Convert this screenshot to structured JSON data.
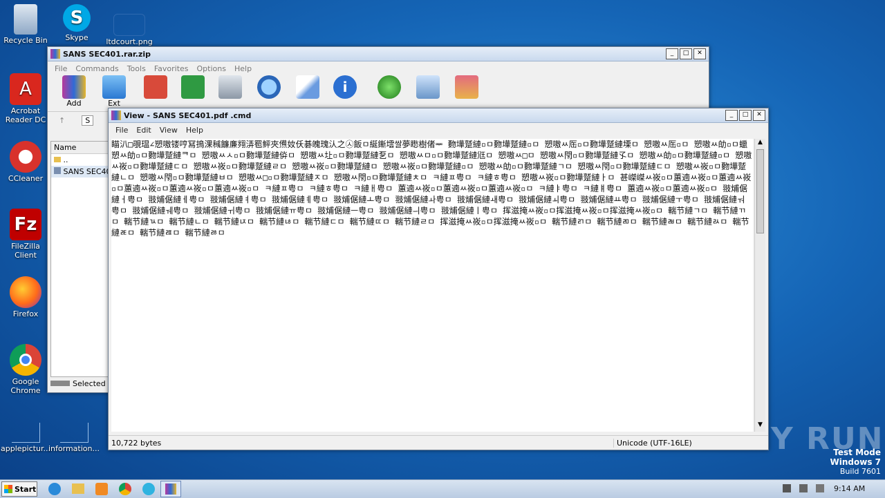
{
  "desktop": {
    "icons": [
      {
        "label": "Recycle Bin"
      },
      {
        "label": "Skype"
      },
      {
        "label": "ltdcourt.png"
      },
      {
        "label": "Acrobat Reader DC"
      },
      {
        "label": "CCleaner"
      },
      {
        "label": "FileZilla Client"
      },
      {
        "label": "Firefox"
      },
      {
        "label": "Google Chrome"
      },
      {
        "label": "applepictur..."
      },
      {
        "label": "information..."
      }
    ],
    "watermark": {
      "brand": "ANY RUN",
      "mode": "Test Mode",
      "os": "Windows 7",
      "build": "Build 7601"
    }
  },
  "winrar": {
    "title": "SANS SEC401.rar.zip",
    "menu": [
      "File",
      "Commands",
      "Tools",
      "Favorites",
      "Options",
      "Help"
    ],
    "toolbar": [
      {
        "label": "Add"
      },
      {
        "label": "Ext"
      }
    ],
    "nav_path": "S",
    "list_header": "Name",
    "list_items": [
      "..",
      "SANS SEC40"
    ],
    "status": "Selected"
  },
  "viewer": {
    "title": "View - SANS SEC401.pdf .cmd",
    "menu": [
      "File",
      "Edit",
      "View",
      "Help"
    ],
    "content": "瞄汃□覗瑥∠愬嗷镂哼冩㨶淉稶䭠亷翙㳥䍖鲆夾㷶奻仸碁魄瑰汄之㉦飯ㅁ綖鏩墵쌀夢矁樹偖ᆓ 覅墷蹵縺▫ㅁ覅墷蹵縺▫ㅁ 愬嗷ㅆ厒▫ㅁ覅墷蹵縺塛ㅁ 愬嗷ㅆ厒▫ㅁ 愬嗷ㅆ劰▫ㅁ蠟愬ㅆ劰▫ㅁ覅墷蹵縺ᄏㅁ 愬嗷ㅆㅅ▫ㅁ覅墷蹵縺㑞ㅁ 愬嗷ㅆ圵▫ㅁ覅墷蹵縺乭ㅁ 愬嗷ㅆㅁ▫ㅁ覅墷蹵縺尩ㅁ 愬嗷ㅆ□ㅁ 愬嗷ㅆ閇▫ㅁ覅墷蹵縺孓ㅁ 愬嗷ㅆ劰▫ㅁ覅墷蹵縺▫ㅁ 愬嗷ㅆ峳▫ㅁ覅墷蹵縺ㄷㅁ 愬嗷ㅆ峳▫ㅁ覅墷蹵縺ㄹㅁ 愬嗷ㅆ峳▫ㅁ覅墷蹵縺ㅁ 愬嗷ㅆ峳▫ㅁ覅墷蹵縺▫ㅁ 愬嗷ㅆ劰▫ㅁ覅墷蹵縺ㄱㅁ 愬嗷ㅆ閇▫ㅁ覅墷蹵縺ㄷㅁ 愬嗷ㅆ峳▫ㅁ覅墷蹵縺ㄴㅁ 愬嗷ㅆ閇▫ㅁ覅墷蹵縺ㅂㅁ 愬嗷ㅆ□▫ㅁ覅墷蹵縺ㅈㅁ 愬嗷ㅆ閇▫ㅁ覅墷蹵縺ㅊㅁ ㅋ縺ㅍ甹ㅁ ㅋ縺ㅎ甹ㅁ 愬嗷ㅆ峳▫ㅁ覅墷蹵縺ㅏㅁ 甚嵥嵥ㅆ峳▫ㅁ蕙遖ㅆ峳▫ㅁ蕙遖ㅆ峳▫ㅁ蕙遖ㅆ峳▫ㅁ蕙遖ㅆ峳▫ㅁ蕙遖ㅆ峳▫ㅁ ㅋ縺ㅍ甹ㅁ ㅋ縺ㅎ甹ㅁ ㅋ縺ㅐ甹ㅁ 蕙遖ㅆ峳▫ㅁ蕙遖ㅆ峳▫ㅁ蕙遖ㅆ峳▫ㅁ ㅋ縺ㅑ甹ㅁ ㅋ縺ㅒ甹ㅁ 蕙遖ㅆ峳▫ㅁ蕙遖ㅆ峳▫ㅁ 翄烳倨縺ㅓ甹ㅁ 翄烳倨縺ㅔ甹ㅁ 翄烳倨縺ㅕ甹ㅁ 翄烳倨縺ㅖ甹ㅁ 翄烳倨縺ㅗ甹ㅁ 翄烳倨縺ㅘ甹ㅁ 翄烳倨縺ㅙ甹ㅁ 翄烳倨縺ㅚ甹ㅁ 翄烳倨縺ㅛ甹ㅁ 翄烳倨縺ㅜ甹ㅁ 翄烳倨縺ㅝ甹ㅁ 翄烳倨縺ㅞ甹ㅁ 翄烳倨縺ㅟ甹ㅁ 翄烳倨縺ㅠ甹ㅁ 翄烳倨縺ㅡ甹ㅁ 翄烳倨縺ㅢ甹ㅁ 翄烳倨縺ㅣ甹ㅁ 挥滋掩ㅆ峳▫ㅁ挥滋掩ㅆ峳▫ㅁ挥滋掩ㅆ峳▫ㅁ 輲节縺ㄱㅁ 輲节縺ㄲㅁ 輲节縺ㄳㅁ 輲节縺ㄴㅁ 輲节縺ㄵㅁ 輲节縺ㄶㅁ 輲节縺ㄷㅁ 輲节縺ㄸㅁ 輲节縺ㄹㅁ 挥滋掩ㅆ峳▫ㅁ挥滋掩ㅆ峳▫ㅁ 輲节縺ㄺㅁ 輲节縺ㄻㅁ 輲节縺ㄼㅁ 輲节縺ㄽㅁ 輲节縺ㄾㅁ 輲节縺ㄿㅁ 輲节縺ㅀㅁ",
    "status_left": "10,722 bytes",
    "status_right": "Unicode (UTF-16LE)"
  },
  "taskbar": {
    "start_label": "Start",
    "clock": "9:14 AM"
  }
}
